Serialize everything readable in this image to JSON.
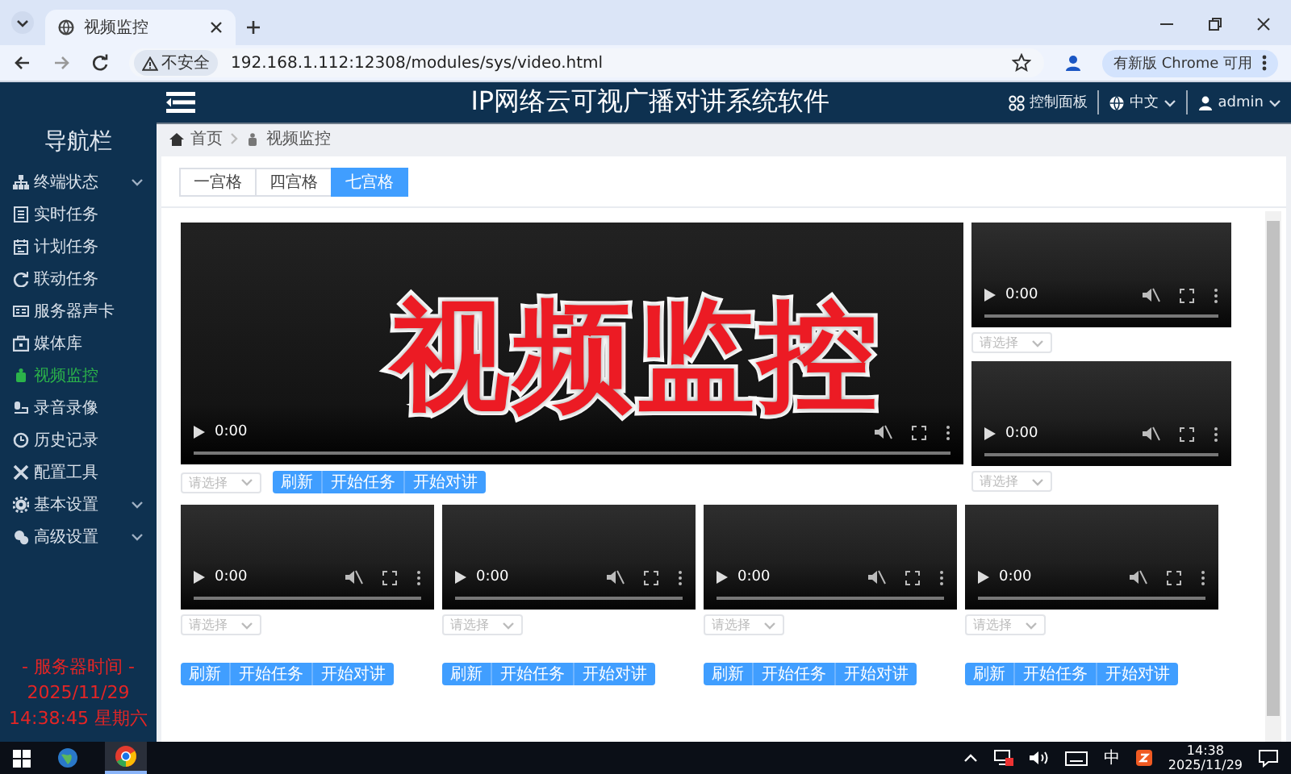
{
  "browser": {
    "tab_title": "视频监控",
    "security_label": "不安全",
    "url": "192.168.1.112:12308/modules/sys/video.html",
    "update_badge": "有新版 Chrome 可用"
  },
  "header": {
    "title": "IP网络云可视广播对讲系统软件",
    "links": [
      {
        "kind": "dashboard",
        "label": "控制面板",
        "dropdown": false
      },
      {
        "kind": "language",
        "label": "中文",
        "dropdown": true
      },
      {
        "kind": "user",
        "label": "admin",
        "dropdown": true
      }
    ]
  },
  "sidebar": {
    "title": "导航栏",
    "items": [
      {
        "label": "终端状态",
        "selected": false,
        "expandable": true
      },
      {
        "label": "实时任务",
        "selected": false,
        "expandable": false
      },
      {
        "label": "计划任务",
        "selected": false,
        "expandable": false
      },
      {
        "label": "联动任务",
        "selected": false,
        "expandable": false
      },
      {
        "label": "服务器声卡",
        "selected": false,
        "expandable": false
      },
      {
        "label": "媒体库",
        "selected": false,
        "expandable": false
      },
      {
        "label": "视频监控",
        "selected": true,
        "expandable": false
      },
      {
        "label": "录音录像",
        "selected": false,
        "expandable": false
      },
      {
        "label": "历史记录",
        "selected": false,
        "expandable": false
      },
      {
        "label": "配置工具",
        "selected": false,
        "expandable": false
      },
      {
        "label": "基本设置",
        "selected": false,
        "expandable": true
      },
      {
        "label": "高级设置",
        "selected": false,
        "expandable": true
      }
    ],
    "server_time": {
      "heading": "- 服务器时间 -",
      "date": "2025/11/29",
      "time": "14:38:45 星期六"
    }
  },
  "breadcrumb": [
    "首页",
    "视频监控"
  ],
  "layout_tabs": [
    {
      "label": "一宫格",
      "selected": false
    },
    {
      "label": "四宫格",
      "selected": false
    },
    {
      "label": "七宫格",
      "selected": true
    }
  ],
  "main_video": {
    "time": "0:00",
    "select": {
      "placeholder": "请选择"
    },
    "buttons": [
      "刷新",
      "开始任务",
      "开始对讲"
    ]
  },
  "side_videos": [
    {
      "time": "0:00",
      "select": {
        "placeholder": "请选择"
      }
    },
    {
      "time": "0:00",
      "select": {
        "placeholder": "请选择"
      }
    }
  ],
  "bottom_videos": [
    {
      "time": "0:00",
      "select": {
        "placeholder": "请选择"
      },
      "buttons": [
        "刷新",
        "开始任务",
        "开始对讲"
      ]
    },
    {
      "time": "0:00",
      "select": {
        "placeholder": "请选择"
      },
      "buttons": [
        "刷新",
        "开始任务",
        "开始对讲"
      ]
    },
    {
      "time": "0:00",
      "select": {
        "placeholder": "请选择"
      },
      "buttons": [
        "刷新",
        "开始任务",
        "开始对讲"
      ]
    },
    {
      "time": "0:00",
      "select": {
        "placeholder": "请选择"
      },
      "buttons": [
        "刷新",
        "开始任务",
        "开始对讲"
      ]
    }
  ],
  "overlay_caption": "视频监控",
  "taskbar": {
    "ime": "中",
    "time": "14:38",
    "date": "2025/11/29"
  }
}
